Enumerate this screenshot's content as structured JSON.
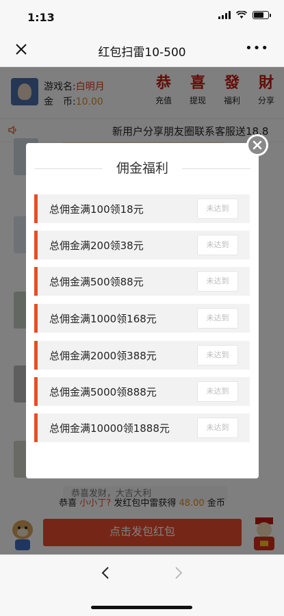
{
  "status_bar": {
    "time": "1:13"
  },
  "nav": {
    "title": "红包扫雷10-500"
  },
  "header": {
    "name_label": "游戏名:",
    "name_value": "白明月",
    "coin_label": "金　币:",
    "coin_value": "10.00",
    "actions": [
      {
        "glyph": "恭",
        "label": "充值"
      },
      {
        "glyph": "喜",
        "label": "提现"
      },
      {
        "glyph": "發",
        "label": "福利"
      },
      {
        "glyph": "財",
        "label": "分享"
      }
    ]
  },
  "marquee": {
    "text": "新用户分享朋友圈联系客服送18.8"
  },
  "feed": {
    "bless_text": "恭喜发财，大吉大利"
  },
  "win_notice": {
    "prefix": "恭喜",
    "name": "小小丁?",
    "middle": "发红包中雷获得",
    "amount": "48.00",
    "suffix": "金币"
  },
  "bottom": {
    "send_label": "点击发包红包"
  },
  "modal": {
    "title": "佣金福利",
    "rows": [
      {
        "label": "总佣金满100领18元",
        "status": "未达到"
      },
      {
        "label": "总佣金满200领38元",
        "status": "未达到"
      },
      {
        "label": "总佣金满500领88元",
        "status": "未达到"
      },
      {
        "label": "总佣金满1000领168元",
        "status": "未达到"
      },
      {
        "label": "总佣金满2000领388元",
        "status": "未达到"
      },
      {
        "label": "总佣金满5000领888元",
        "status": "未达到"
      },
      {
        "label": "总佣金满10000领1888元",
        "status": "未达到"
      }
    ]
  },
  "colors": {
    "accent": "#ea4b23",
    "gold": "#e38b1b",
    "red": "#d43a1a"
  }
}
